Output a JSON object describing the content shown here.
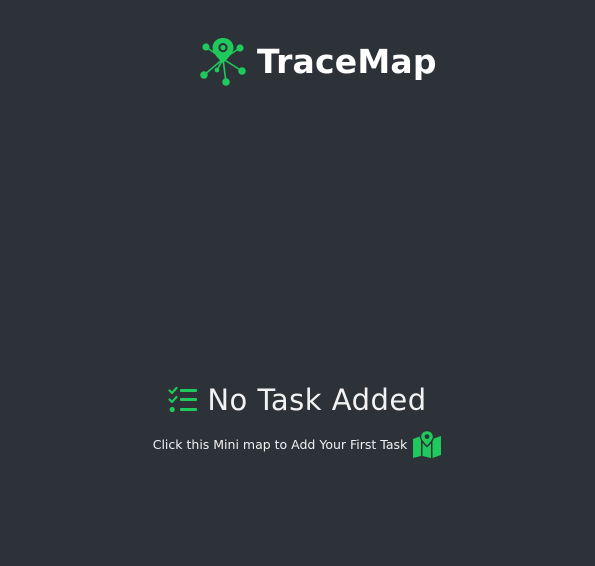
{
  "app": {
    "name": "TraceMap",
    "logo_icon": "network-pin-icon",
    "accent_color": "#1fc95b",
    "background_color": "#2d3138"
  },
  "empty_state": {
    "title": "No Task Added",
    "title_icon": "list-check-icon",
    "subtitle": "Click this Mini map to Add Your First Task",
    "subtitle_icon": "mini-map-icon"
  }
}
